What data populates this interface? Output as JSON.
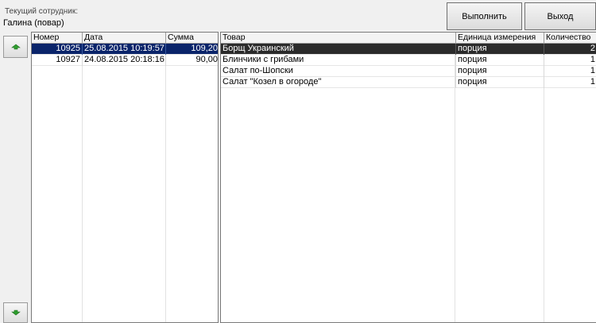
{
  "employee": {
    "caption": "Текущий сотрудник:",
    "name": "Галина (повар)"
  },
  "toolbar": {
    "execute_label": "Выполнить",
    "exit_label": "Выход"
  },
  "nav": {
    "up_icon": "arrow-up-icon",
    "down_icon": "arrow-down-icon",
    "arrow_color": "#2e9e2e"
  },
  "orders": {
    "headers": [
      "Номер",
      "Дата",
      "Сумма"
    ],
    "rows": [
      {
        "number": "10925",
        "date": "25.08.2015 10:19:57",
        "sum": "109,20",
        "selected": true
      },
      {
        "number": "10927",
        "date": "24.08.2015 20:18:16",
        "sum": "90,00",
        "selected": false
      }
    ],
    "selection_color": "#0a246a"
  },
  "items": {
    "headers": [
      "Товар",
      "Единица измерения",
      "Количество"
    ],
    "rows": [
      {
        "product": "Борщ Украинский",
        "unit": "порция",
        "qty": "2",
        "selected": true
      },
      {
        "product": "Блинчики с грибами",
        "unit": "порция",
        "qty": "1",
        "selected": false
      },
      {
        "product": "Салат по-Шопски",
        "unit": "порция",
        "qty": "1",
        "selected": false
      },
      {
        "product": "Салат \"Козел в огороде\"",
        "unit": "порция",
        "qty": "1",
        "selected": false
      }
    ],
    "selection_color": "#2b2b2b"
  }
}
